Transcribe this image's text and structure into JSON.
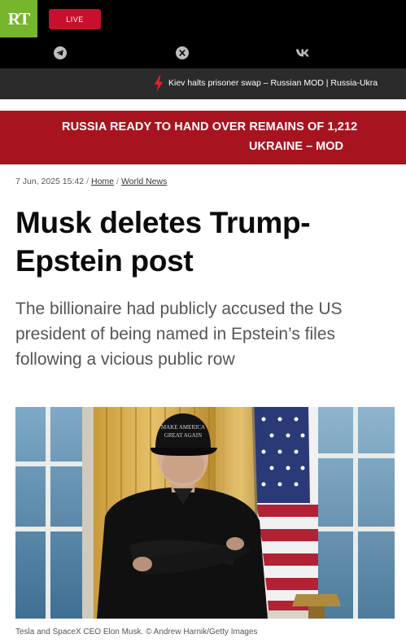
{
  "header": {
    "logo_text": "RT",
    "live_label": "LIVE",
    "logo_color": "#77b52c",
    "live_color": "#c8102e"
  },
  "social": {
    "icons": [
      "telegram-icon",
      "x-icon",
      "vk-icon"
    ]
  },
  "ticker": {
    "text": "Kiev halts prisoner swap – Russian MOD | Russia-Ukra"
  },
  "breaking": {
    "line1": "RUSSIA READY TO HAND OVER REMAINS OF 1,212",
    "line2": "UKRAINE – MOD",
    "color": "#a7141f"
  },
  "article": {
    "date": "7 Jun, 2025 15:42",
    "breadcrumb_home": "Home",
    "breadcrumb_section": "World News",
    "title": "Musk deletes Trump-Epstein post",
    "summary": "The billionaire had publicly accused the US president of being named in Epstein’s files following a vicious public row",
    "photo_caption": "Tesla and SpaceX CEO Elon Musk. © Andrew Harnik/Getty Images",
    "cap_text_line1": "MAKE AMERICA",
    "cap_text_line2": "GREAT AGAIN"
  }
}
